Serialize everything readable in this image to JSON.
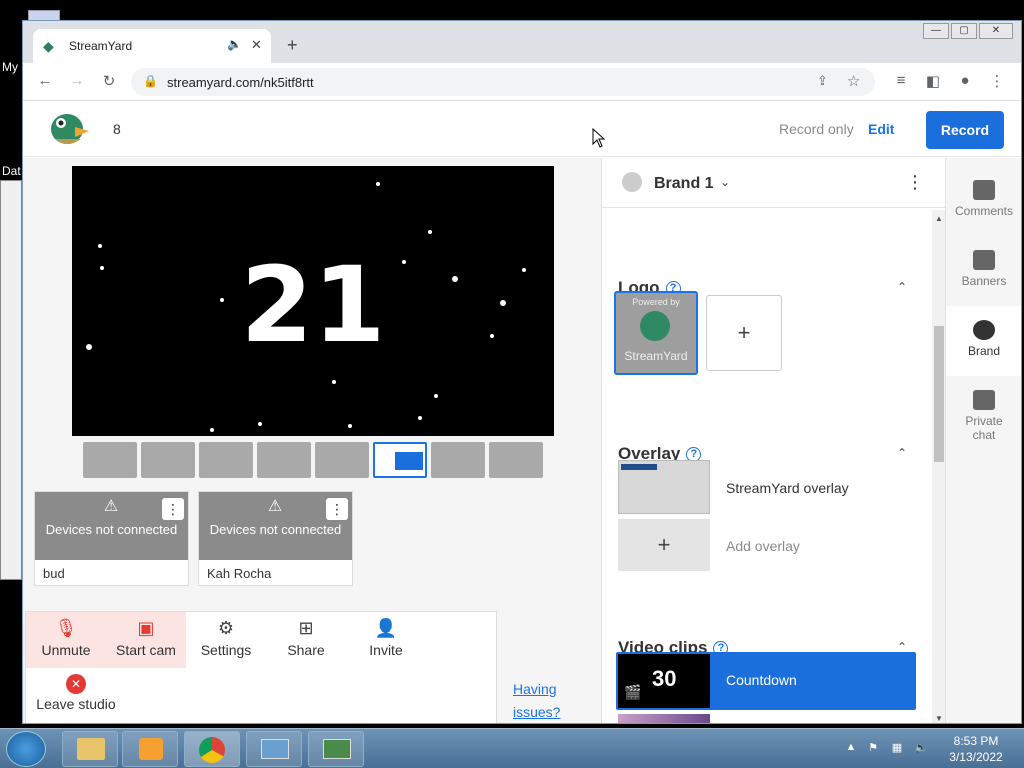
{
  "desktop": {
    "icon_labels": [
      "My",
      "Dat"
    ]
  },
  "browser": {
    "tab_title": "StreamYard",
    "url": "streamyard.com/nk5itf8rtt",
    "window_controls": [
      "—",
      "▢",
      "✕"
    ]
  },
  "header": {
    "count": "8",
    "record_only": "Record only",
    "edit": "Edit",
    "record": "Record"
  },
  "stage": {
    "countdown_number": "21"
  },
  "guests": [
    {
      "message": "Devices not connected",
      "name": "bud"
    },
    {
      "message": "Devices not connected",
      "name": "Kah Rocha"
    }
  ],
  "controls": {
    "unmute": "Unmute",
    "start_cam": "Start cam",
    "settings": "Settings",
    "share": "Share",
    "invite": "Invite",
    "leave": "Leave studio",
    "having_issues": "Having issues?"
  },
  "brand_panel": {
    "brand_name": "Brand 1",
    "logo_title": "Logo",
    "logo_thumb_text_top": "Powered by",
    "logo_thumb_text_bottom": "StreamYard",
    "overlay_title": "Overlay",
    "overlay_item": "StreamYard overlay",
    "add_overlay": "Add overlay",
    "video_clips_title": "Video clips",
    "clip_number": "30",
    "clip_name": "Countdown"
  },
  "side_nav": [
    {
      "label": "Comments",
      "icon": "comment-icon"
    },
    {
      "label": "Banners",
      "icon": "banner-icon"
    },
    {
      "label": "Brand",
      "icon": "palette-icon"
    },
    {
      "label": "Private chat",
      "icon": "private-chat-icon"
    }
  ],
  "taskbar": {
    "time": "8:53 PM",
    "date": "3/13/2022"
  },
  "colors": {
    "accent": "#1a6fdc",
    "danger": "#e53935",
    "stage_bg": "#000000"
  }
}
